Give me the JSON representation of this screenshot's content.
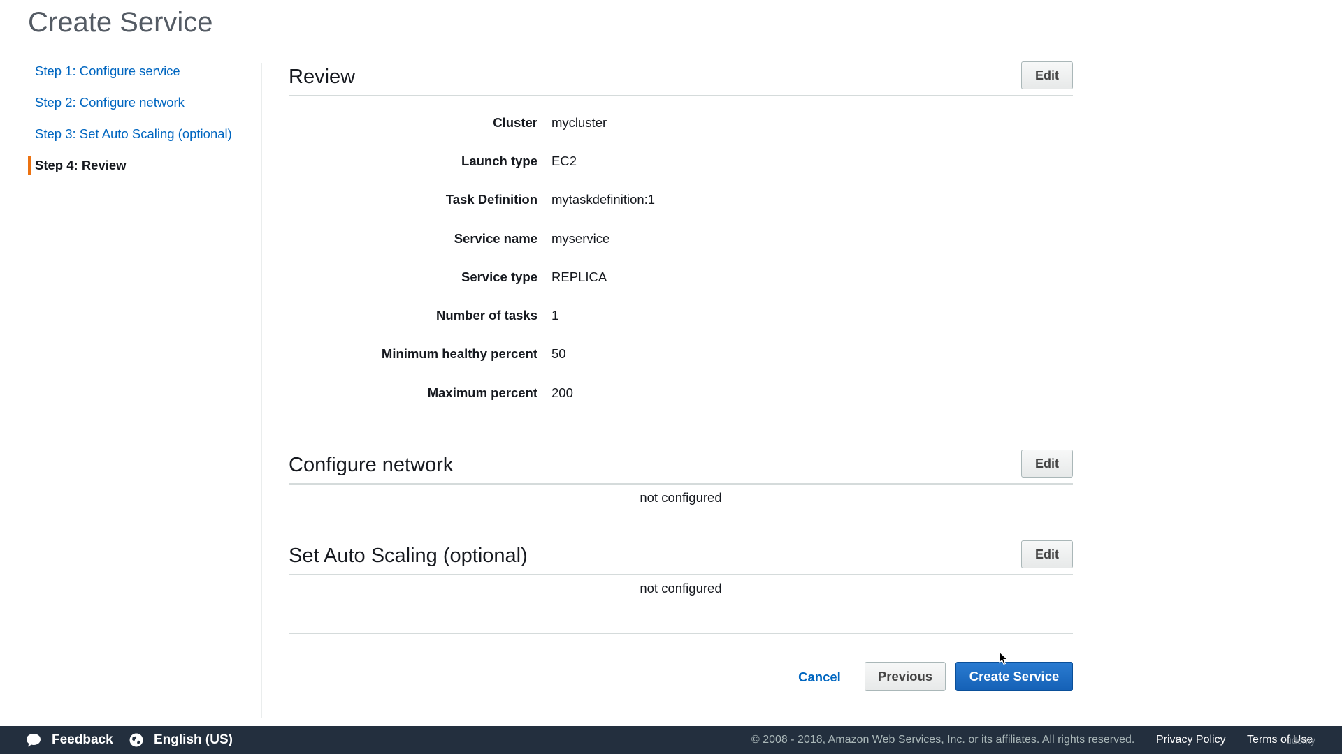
{
  "page": {
    "title": "Create Service"
  },
  "steps": [
    {
      "label": "Step 1: Configure service"
    },
    {
      "label": "Step 2: Configure network"
    },
    {
      "label": "Step 3: Set Auto Scaling (optional)"
    },
    {
      "label": "Step 4: Review",
      "active": true
    }
  ],
  "review": {
    "title": "Review",
    "edit_label": "Edit",
    "fields": [
      {
        "label": "Cluster",
        "value": "mycluster"
      },
      {
        "label": "Launch type",
        "value": "EC2"
      },
      {
        "label": "Task Definition",
        "value": "mytaskdefinition:1"
      },
      {
        "label": "Service name",
        "value": "myservice"
      },
      {
        "label": "Service type",
        "value": "REPLICA"
      },
      {
        "label": "Number of tasks",
        "value": "1"
      },
      {
        "label": "Minimum healthy percent",
        "value": "50"
      },
      {
        "label": "Maximum percent",
        "value": "200"
      }
    ]
  },
  "network": {
    "title": "Configure network",
    "edit_label": "Edit",
    "status": "not configured"
  },
  "autoscaling": {
    "title": "Set Auto Scaling (optional)",
    "edit_label": "Edit",
    "status": "not configured"
  },
  "actions": {
    "cancel": "Cancel",
    "previous": "Previous",
    "create": "Create Service"
  },
  "footer": {
    "feedback": "Feedback",
    "language": "English (US)",
    "copyright": "© 2008 - 2018, Amazon Web Services, Inc. or its affiliates. All rights reserved.",
    "privacy": "Privacy Policy",
    "terms": "Terms of Use",
    "watermark": "udemy"
  },
  "colors": {
    "accent": "#ec7211",
    "link": "#0066c0",
    "primary": "#1561b6",
    "footer_bg": "#232f3e"
  },
  "icons": {
    "feedback": "speech-bubble-icon",
    "language": "globe-icon",
    "cursor": "mouse-pointer-icon"
  }
}
